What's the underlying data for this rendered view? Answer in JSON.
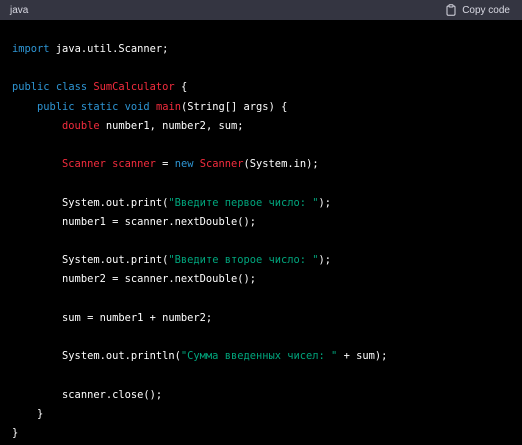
{
  "header": {
    "language": "java",
    "copy_label": "Copy code",
    "copy_icon": "clipboard-icon"
  },
  "colors": {
    "keyword": "#2e95d3",
    "class_name": "#f22c3d",
    "string": "#00a67d",
    "plain": "#ffffff",
    "header_bg": "#343541",
    "code_bg": "#000000"
  },
  "code_lines": [
    [
      {
        "t": "kw",
        "v": "import"
      },
      {
        "t": "pl",
        "v": " java.util.Scanner;"
      }
    ],
    [],
    [
      {
        "t": "kw",
        "v": "public"
      },
      {
        "t": "pl",
        "v": " "
      },
      {
        "t": "kw",
        "v": "class"
      },
      {
        "t": "pl",
        "v": " "
      },
      {
        "t": "cls",
        "v": "SumCalculator"
      },
      {
        "t": "pl",
        "v": " {"
      }
    ],
    [
      {
        "t": "pl",
        "v": "    "
      },
      {
        "t": "kw",
        "v": "public"
      },
      {
        "t": "pl",
        "v": " "
      },
      {
        "t": "kw",
        "v": "static"
      },
      {
        "t": "pl",
        "v": " "
      },
      {
        "t": "kw",
        "v": "void"
      },
      {
        "t": "pl",
        "v": " "
      },
      {
        "t": "cls",
        "v": "main"
      },
      {
        "t": "pl",
        "v": "(String[] args) {"
      }
    ],
    [
      {
        "t": "pl",
        "v": "        "
      },
      {
        "t": "cls",
        "v": "double"
      },
      {
        "t": "pl",
        "v": " number1, number2, sum;"
      }
    ],
    [],
    [
      {
        "t": "pl",
        "v": "        "
      },
      {
        "t": "cls",
        "v": "Scanner"
      },
      {
        "t": "pl",
        "v": " "
      },
      {
        "t": "cls",
        "v": "scanner"
      },
      {
        "t": "pl",
        "v": " = "
      },
      {
        "t": "kw",
        "v": "new"
      },
      {
        "t": "pl",
        "v": " "
      },
      {
        "t": "cls",
        "v": "Scanner"
      },
      {
        "t": "pl",
        "v": "(System.in);"
      }
    ],
    [],
    [
      {
        "t": "pl",
        "v": "        System.out.print("
      },
      {
        "t": "str",
        "v": "\"Введите первое число: \""
      },
      {
        "t": "pl",
        "v": ");"
      }
    ],
    [
      {
        "t": "pl",
        "v": "        number1 = scanner.nextDouble();"
      }
    ],
    [],
    [
      {
        "t": "pl",
        "v": "        System.out.print("
      },
      {
        "t": "str",
        "v": "\"Введите второе число: \""
      },
      {
        "t": "pl",
        "v": ");"
      }
    ],
    [
      {
        "t": "pl",
        "v": "        number2 = scanner.nextDouble();"
      }
    ],
    [],
    [
      {
        "t": "pl",
        "v": "        sum = number1 + number2;"
      }
    ],
    [],
    [
      {
        "t": "pl",
        "v": "        System.out.println("
      },
      {
        "t": "str",
        "v": "\"Сумма введенных чисел: \""
      },
      {
        "t": "pl",
        "v": " + sum);"
      }
    ],
    [],
    [
      {
        "t": "pl",
        "v": "        scanner.close();"
      }
    ],
    [
      {
        "t": "pl",
        "v": "    }"
      }
    ],
    [
      {
        "t": "pl",
        "v": "}"
      }
    ]
  ]
}
